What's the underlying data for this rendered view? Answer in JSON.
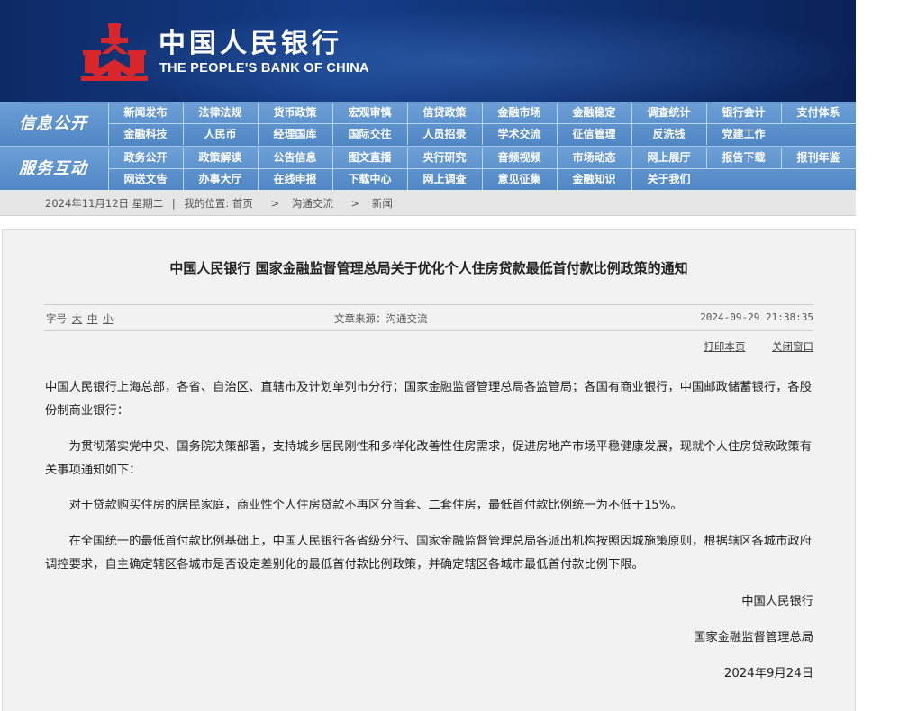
{
  "header": {
    "bank_name_cn": "中国人民银行",
    "bank_name_en": "THE PEOPLE'S BANK OF CHINA",
    "logo_icon": "pboc-logo-icon"
  },
  "nav": {
    "rows": [
      {
        "label": "信息公开",
        "top": [
          "新闻发布",
          "法律法规",
          "货币政策",
          "宏观审慎",
          "信贷政策",
          "金融市场",
          "金融稳定",
          "调查统计",
          "银行会计",
          "支付体系"
        ],
        "bottom": [
          "金融科技",
          "人民币",
          "经理国库",
          "国际交往",
          "人员招录",
          "学术交流",
          "征信管理",
          "反洗钱",
          "党建工作"
        ]
      },
      {
        "label": "服务互动",
        "top": [
          "政务公开",
          "政策解读",
          "公告信息",
          "图文直播",
          "央行研究",
          "音频视频",
          "市场动态",
          "网上展厅",
          "报告下载",
          "报刊年鉴"
        ],
        "bottom": [
          "网送文告",
          "办事大厅",
          "在线申报",
          "下载中心",
          "网上调查",
          "意见征集",
          "金融知识",
          "关于我们"
        ]
      }
    ]
  },
  "breadcrumb": {
    "date": "2024年11月12日 星期二",
    "separator": "|",
    "location_label": "我的位置:",
    "items": [
      "首页",
      "沟通交流",
      "新闻"
    ],
    "arrow": ">"
  },
  "article": {
    "title": "中国人民银行 国家金融监督管理总局关于优化个人住房贷款最低首付款比例政策的通知",
    "font_size_label": "字号",
    "font_sizes": [
      "大",
      "中",
      "小"
    ],
    "source": "文章来源：沟通交流",
    "datetime": "2024-09-29 21:38:35",
    "print_label": "打印本页",
    "close_label": "关闭窗口",
    "paragraphs": [
      "中国人民银行上海总部，各省、自治区、直辖市及计划单列市分行；国家金融监督管理总局各监管局；各国有商业银行，中国邮政储蓄银行，各股份制商业银行：",
      "为贯彻落实党中央、国务院决策部署，支持城乡居民刚性和多样化改善性住房需求，促进房地产市场平稳健康发展，现就个人住房贷款政策有关事项通知如下：",
      "对于贷款购买住房的居民家庭，商业性个人住房贷款不再区分首套、二套住房，最低首付款比例统一为不低于15%。",
      "在全国统一的最低首付款比例基础上，中国人民银行各省级分行、国家金融监督管理总局各派出机构按照因城施策原则，根据辖区各城市政府调控要求，自主确定辖区各城市是否设定差别化的最低首付款比例政策，并确定辖区各城市最低首付款比例下限。"
    ],
    "signatures": [
      "中国人民银行",
      "国家金融监督管理总局",
      "2024年9月24日"
    ]
  },
  "colors": {
    "banner": "#143c86",
    "nav": "#5a8ec9",
    "logo_red": "#d8262b"
  }
}
